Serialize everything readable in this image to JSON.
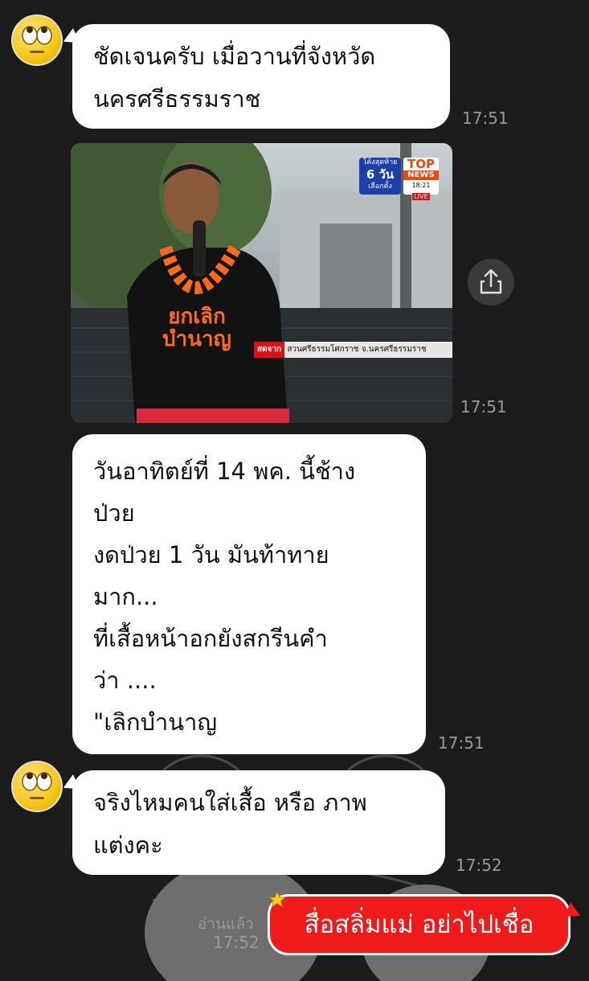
{
  "messages": [
    {
      "text": "ชัดเจนครับ เมื่อวานที่จังหวัด\nนครศรีธรรมราช",
      "time": "17:51"
    },
    {
      "time": "17:51"
    },
    {
      "text": "วันอาทิตย์ที่ 14  พค. นี้ช้าง\nป่วย\nงดป่วย 1 วัน มันท้าทาย\nมาก...\nที่เสื้อหน้าอกยังสกรีนคำ\nว่า ....\n\"เลิกบำนาญ",
      "time": "17:51"
    },
    {
      "text": "จริงไหมคนใส่เสื้อ หรือ ภาพ\nแต่งคะ",
      "time": "17:52"
    },
    {
      "text": "สื่อสลิ่มแม่ อย่าไปเชื่อ",
      "time": "17:52",
      "read": "อ่านแล้ว"
    }
  ],
  "media_overlay": {
    "countdown_top": "โค้งสุดท้าย",
    "countdown_days": "6 วัน",
    "countdown_bottom": "เลือกตั้ง",
    "channel_top": "TOP",
    "channel_bottom": "NEWS",
    "channel_time": "18:21",
    "live": "LIVE",
    "live_from": "สดจาก",
    "location": "สวนศรีธรรมโศกราช จ.นครศรีธรรมราช",
    "shirt_line1": "ยกเลิก",
    "shirt_line2": "บำนาญ"
  },
  "colors": {
    "background": "#1c1c1c",
    "bubble": "#ffffff",
    "sent_bubble": "#ef1b1b",
    "time": "#9a9a9a"
  }
}
